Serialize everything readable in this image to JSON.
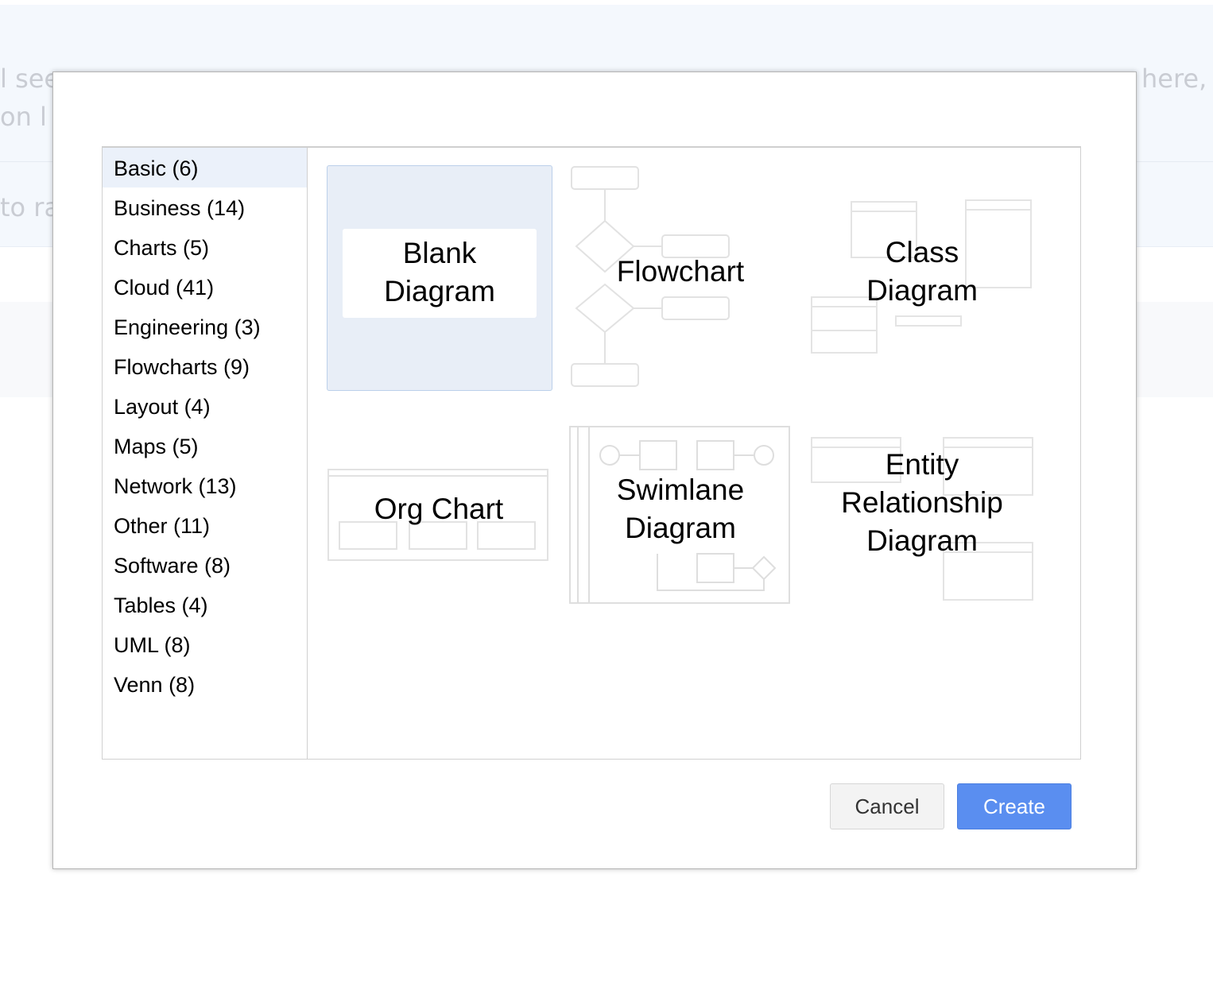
{
  "background": {
    "fragments": [
      "l see",
      "here, i",
      "on l",
      "to ra"
    ]
  },
  "dialog": {
    "categories": [
      "Basic (6)",
      "Business (14)",
      "Charts (5)",
      "Cloud (41)",
      "Engineering (3)",
      "Flowcharts (9)",
      "Layout (4)",
      "Maps (5)",
      "Network (13)",
      "Other (11)",
      "Software (8)",
      "Tables (4)",
      "UML (8)",
      "Venn (8)"
    ],
    "selected_category": "Basic (6)",
    "templates": [
      {
        "line1": "Blank",
        "line2": "Diagram",
        "selected": true
      },
      {
        "line1": "Flowchart"
      },
      {
        "line1": "Class",
        "line2": "Diagram"
      },
      {
        "line1": "Org Chart"
      },
      {
        "line1": "Swimlane",
        "line2": "Diagram"
      },
      {
        "line1": "Entity",
        "line2": "Relationship",
        "line3": "Diagram"
      }
    ],
    "cancel_label": "Cancel",
    "create_label": "Create"
  },
  "colors": {
    "accent": "#5a8ef0",
    "selected_bg": "#ebf1fa"
  }
}
